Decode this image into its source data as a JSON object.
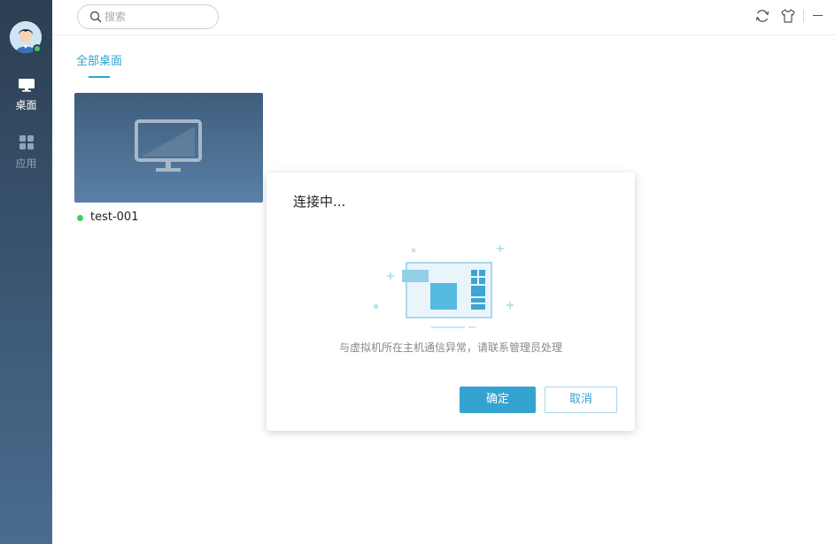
{
  "sidebar": {
    "user_status_color": "#3fcf5e",
    "items": [
      {
        "label": "桌面",
        "icon": "monitor-icon",
        "active": true
      },
      {
        "label": "应用",
        "icon": "apps-grid-icon",
        "active": false
      }
    ]
  },
  "topbar": {
    "search_placeholder": "搜索",
    "icons": [
      "refresh-icon",
      "skin-icon",
      "minimize-icon"
    ]
  },
  "tabs": [
    {
      "label": "全部桌面",
      "active": true
    }
  ],
  "desktops": [
    {
      "name": "test-001",
      "status": "online",
      "status_color": "#3fcf5e"
    }
  ],
  "dialog": {
    "title": "连接中...",
    "message": "与虚拟机所在主机通信异常，请联系管理员处理",
    "ok_label": "确定",
    "cancel_label": "取消"
  },
  "colors": {
    "accent": "#33a3d0",
    "sidebar": "#2c3e52"
  }
}
